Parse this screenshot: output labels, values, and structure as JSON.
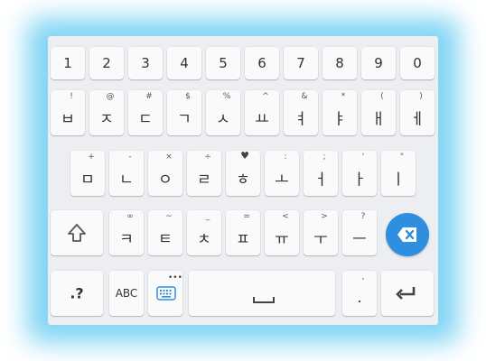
{
  "keyboard": {
    "numbers": [
      "1",
      "2",
      "3",
      "4",
      "5",
      "6",
      "7",
      "8",
      "9",
      "0"
    ],
    "row1": [
      {
        "main": "ㅂ",
        "hint": "!"
      },
      {
        "main": "ㅈ",
        "hint": "@"
      },
      {
        "main": "ㄷ",
        "hint": "#"
      },
      {
        "main": "ㄱ",
        "hint": "$"
      },
      {
        "main": "ㅅ",
        "hint": "%"
      },
      {
        "main": "ㅛ",
        "hint": "^"
      },
      {
        "main": "ㅕ",
        "hint": "&"
      },
      {
        "main": "ㅑ",
        "hint": "*"
      },
      {
        "main": "ㅐ",
        "hint": "("
      },
      {
        "main": "ㅔ",
        "hint": ")"
      }
    ],
    "row2": [
      {
        "main": "ㅁ",
        "hint": "+"
      },
      {
        "main": "ㄴ",
        "hint": "-"
      },
      {
        "main": "ㅇ",
        "hint": "×"
      },
      {
        "main": "ㄹ",
        "hint": "÷"
      },
      {
        "main": "ㅎ",
        "hint": "♥"
      },
      {
        "main": "ㅗ",
        "hint": ":"
      },
      {
        "main": "ㅓ",
        "hint": ";"
      },
      {
        "main": "ㅏ",
        "hint": "'"
      },
      {
        "main": "ㅣ",
        "hint": "\""
      }
    ],
    "row3": [
      {
        "main": "ㅋ",
        "hint": "∞"
      },
      {
        "main": "ㅌ",
        "hint": "~"
      },
      {
        "main": "ㅊ",
        "hint": "_"
      },
      {
        "main": "ㅍ",
        "hint": "="
      },
      {
        "main": "ㅠ",
        "hint": "<"
      },
      {
        "main": "ㅜ",
        "hint": ">"
      },
      {
        "main": "ㅡ",
        "hint": "?"
      }
    ],
    "shift_glyph": "⇧",
    "symbols_label": ".?",
    "abc_label": "ABC",
    "emoji_dots": "•••",
    "period_label": ".",
    "period_hint": ",",
    "colors": {
      "background": "#eceef2",
      "key": "#fafafa",
      "accent": "#2e8ee0",
      "glow": "#55c6f0"
    },
    "icons": {
      "shift": "shift-arrow-icon",
      "backspace": "backspace-icon",
      "keyboard": "keyboard-settings-icon",
      "space": "space-bar-icon",
      "enter": "enter-arrow-icon"
    }
  }
}
